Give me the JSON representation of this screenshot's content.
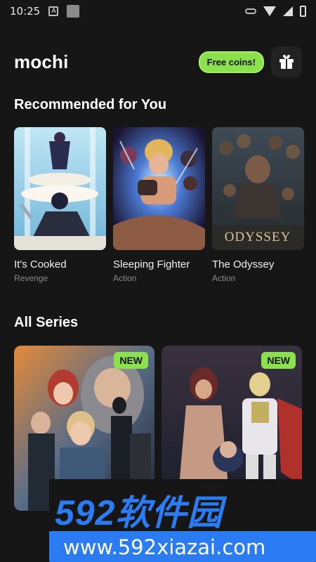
{
  "status_bar": {
    "time": "10:25"
  },
  "header": {
    "logo": "mochi",
    "coins_label": "Free coins!",
    "gift_icon": "gift-icon"
  },
  "recommended": {
    "title": "Recommended for You",
    "items": [
      {
        "name": "It's Cooked",
        "genre": "Revenge"
      },
      {
        "name": "Sleeping Fighter",
        "genre": "Action"
      },
      {
        "name": "The Odyssey",
        "genre": "Action",
        "cover_text": "ODYSSEY"
      }
    ]
  },
  "all_series": {
    "title": "All Series",
    "items": [
      {
        "badge": "NEW"
      },
      {
        "badge": "NEW"
      }
    ]
  },
  "watermark": {
    "main": "592软件园",
    "url": "www.592xiazai.com"
  },
  "colors": {
    "accent": "#8be04e",
    "background": "#161616",
    "watermark_blue": "#2b7bf3"
  }
}
